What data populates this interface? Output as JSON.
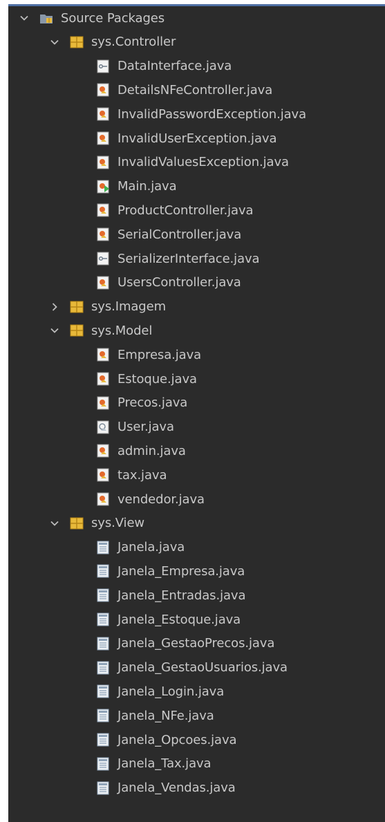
{
  "tree": {
    "root": {
      "label": "Source Packages",
      "icon": "source-packages-icon",
      "expanded": true
    },
    "packages": [
      {
        "label": "sys.Controller",
        "expanded": true,
        "files": [
          {
            "label": "DataInterface.java",
            "icon": "interface-icon"
          },
          {
            "label": "DetailsNFeController.java",
            "icon": "class-icon"
          },
          {
            "label": "InvalidPasswordException.java",
            "icon": "class-icon"
          },
          {
            "label": "InvalidUserException.java",
            "icon": "class-icon"
          },
          {
            "label": "InvalidValuesException.java",
            "icon": "class-icon"
          },
          {
            "label": "Main.java",
            "icon": "main-class-icon"
          },
          {
            "label": "ProductController.java",
            "icon": "class-icon"
          },
          {
            "label": "SerialController.java",
            "icon": "class-icon"
          },
          {
            "label": "SerializerInterface.java",
            "icon": "interface-icon"
          },
          {
            "label": "UsersController.java",
            "icon": "class-icon"
          }
        ]
      },
      {
        "label": "sys.Imagem",
        "expanded": false,
        "files": []
      },
      {
        "label": "sys.Model",
        "expanded": true,
        "files": [
          {
            "label": "Empresa.java",
            "icon": "class-icon"
          },
          {
            "label": "Estoque.java",
            "icon": "class-icon"
          },
          {
            "label": "Precos.java",
            "icon": "class-icon"
          },
          {
            "label": "User.java",
            "icon": "abstract-class-icon"
          },
          {
            "label": "admin.java",
            "icon": "class-icon"
          },
          {
            "label": "tax.java",
            "icon": "class-icon"
          },
          {
            "label": "vendedor.java",
            "icon": "class-icon"
          }
        ]
      },
      {
        "label": "sys.View",
        "expanded": true,
        "files": [
          {
            "label": "Janela.java",
            "icon": "form-icon"
          },
          {
            "label": "Janela_Empresa.java",
            "icon": "form-icon"
          },
          {
            "label": "Janela_Entradas.java",
            "icon": "form-icon"
          },
          {
            "label": "Janela_Estoque.java",
            "icon": "form-icon"
          },
          {
            "label": "Janela_GestaoPrecos.java",
            "icon": "form-icon"
          },
          {
            "label": "Janela_GestaoUsuarios.java",
            "icon": "form-icon"
          },
          {
            "label": "Janela_Login.java",
            "icon": "form-icon"
          },
          {
            "label": "Janela_NFe.java",
            "icon": "form-icon"
          },
          {
            "label": "Janela_Opcoes.java",
            "icon": "form-icon"
          },
          {
            "label": "Janela_Tax.java",
            "icon": "form-icon"
          },
          {
            "label": "Janela_Vendas.java",
            "icon": "form-icon"
          }
        ]
      }
    ]
  },
  "colors": {
    "background": "#2b2b2b",
    "text": "#c8c8c8",
    "package": "#e8b93a",
    "class": "#e36a2c",
    "form": "#8fa3b8"
  }
}
